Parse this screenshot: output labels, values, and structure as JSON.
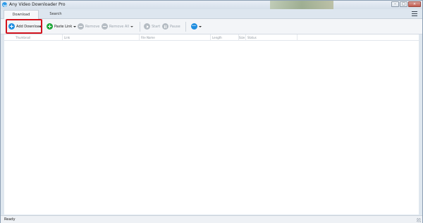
{
  "window": {
    "title": "Any Video Downloader Pro",
    "controls": {
      "minimize": "–",
      "maximize": "□",
      "close": "×"
    }
  },
  "tabs": [
    {
      "label": "Download",
      "active": true
    },
    {
      "label": "Search",
      "active": false
    }
  ],
  "toolbar": {
    "add_download": "Add Download",
    "paste_link": "Paste Link",
    "remove": "Remove",
    "remove_all": "Remove All",
    "start": "Start",
    "pause": "Pause"
  },
  "table": {
    "columns": [
      "Thumbnail",
      "Link",
      "File Name",
      "Length",
      "Size",
      "Status"
    ],
    "rows": []
  },
  "status": {
    "text": "Ready"
  },
  "colors": {
    "accent": "#1e8de0",
    "paste_green": "#1fa83a",
    "highlight": "#d4131d"
  },
  "icons": {
    "app": "download-app-icon",
    "add": "plus-circle-icon",
    "paste": "plus-circle-icon",
    "remove": "minus-circle-icon",
    "start": "play-circle-icon",
    "pause": "pause-circle-icon",
    "more": "more-options-icon",
    "menu": "hamburger-menu-icon"
  }
}
